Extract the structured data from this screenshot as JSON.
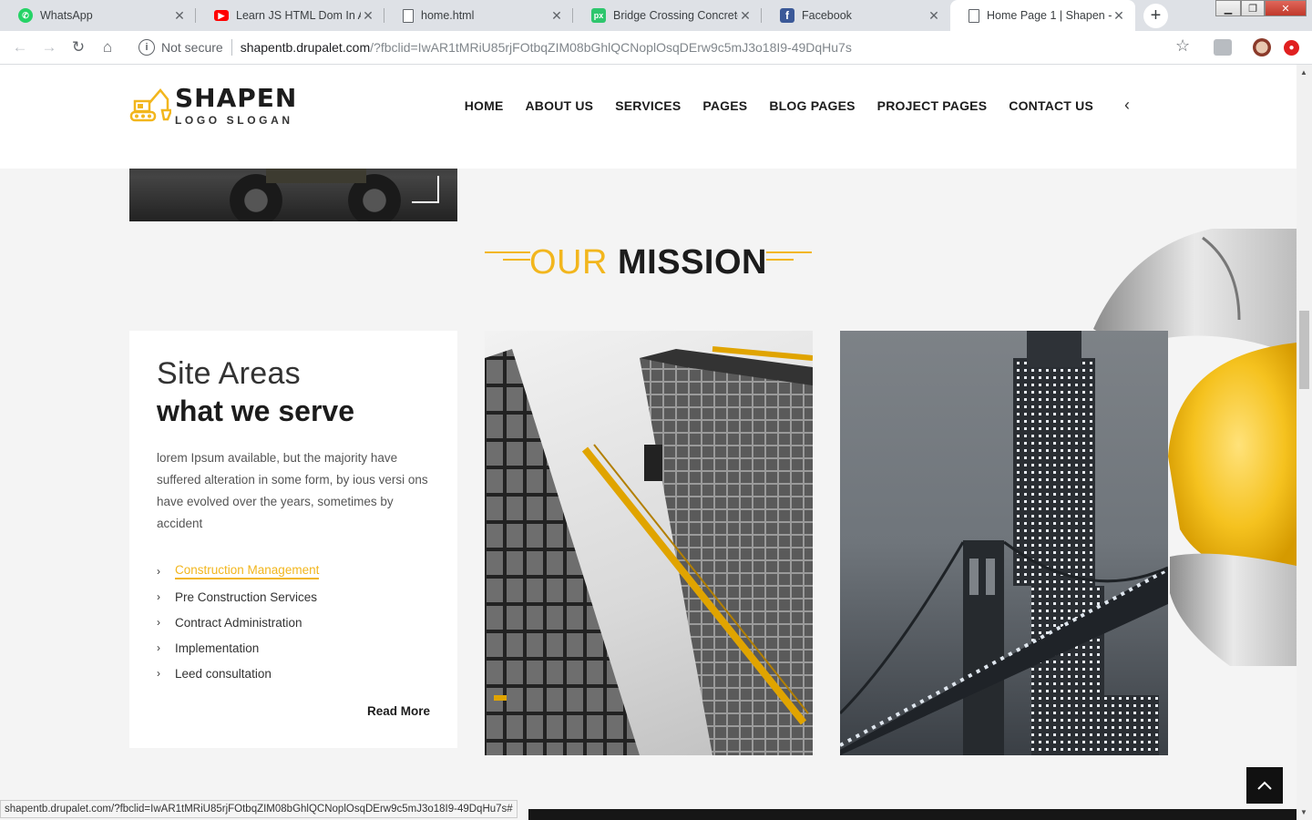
{
  "browser": {
    "tabs": [
      {
        "title": "WhatsApp",
        "icon": "whatsapp-icon",
        "color": "#25d366"
      },
      {
        "title": "Learn JS HTML Dom In Ara",
        "icon": "youtube-icon",
        "color": "#ff0000"
      },
      {
        "title": "home.html",
        "icon": "file-icon",
        "color": "#5f6368"
      },
      {
        "title": "Bridge Crossing Concrete",
        "icon": "pixabay-icon",
        "color": "#2ec66d"
      },
      {
        "title": "Facebook",
        "icon": "facebook-icon",
        "color": "#3b5998"
      },
      {
        "title": "Home Page 1 | Shapen - C",
        "icon": "file-icon",
        "color": "#5f6368",
        "active": true
      }
    ],
    "address": {
      "security": "Not secure",
      "host": "shapentb.drupalet.com",
      "path": "/?fbclid=IwAR1tMRiU85rjFOtbqZIM08bGhlQCNoplOsqDErw9c5mJ3o18I9-49DqHu7s"
    },
    "status_url": "shapentb.drupalet.com/?fbclid=IwAR1tMRiU85rjFOtbqZIM08bGhlQCNoplOsqDErw9c5mJ3o18I9-49DqHu7s#"
  },
  "site": {
    "logo": {
      "name": "SHAPEN",
      "slogan": "LOGO SLOGAN"
    },
    "nav": [
      "HOME",
      "ABOUT US",
      "SERVICES",
      "PAGES",
      "BLOG PAGES",
      "PROJECT PAGES",
      "CONTACT US"
    ],
    "mission": {
      "light": "OUR",
      "bold": "MISSION"
    },
    "card": {
      "subtitle": "Site Areas",
      "title": "what we serve",
      "body": "lorem Ipsum available, but the majority have suffered alteration in some form, by ious versi ons have evolved over the years, sometimes by accident",
      "services": [
        "Construction Management",
        "Pre Construction Services",
        "Contract Administration",
        "Implementation",
        "Leed consultation"
      ],
      "read_more": "Read More"
    },
    "accent_color": "#f2b61d"
  }
}
